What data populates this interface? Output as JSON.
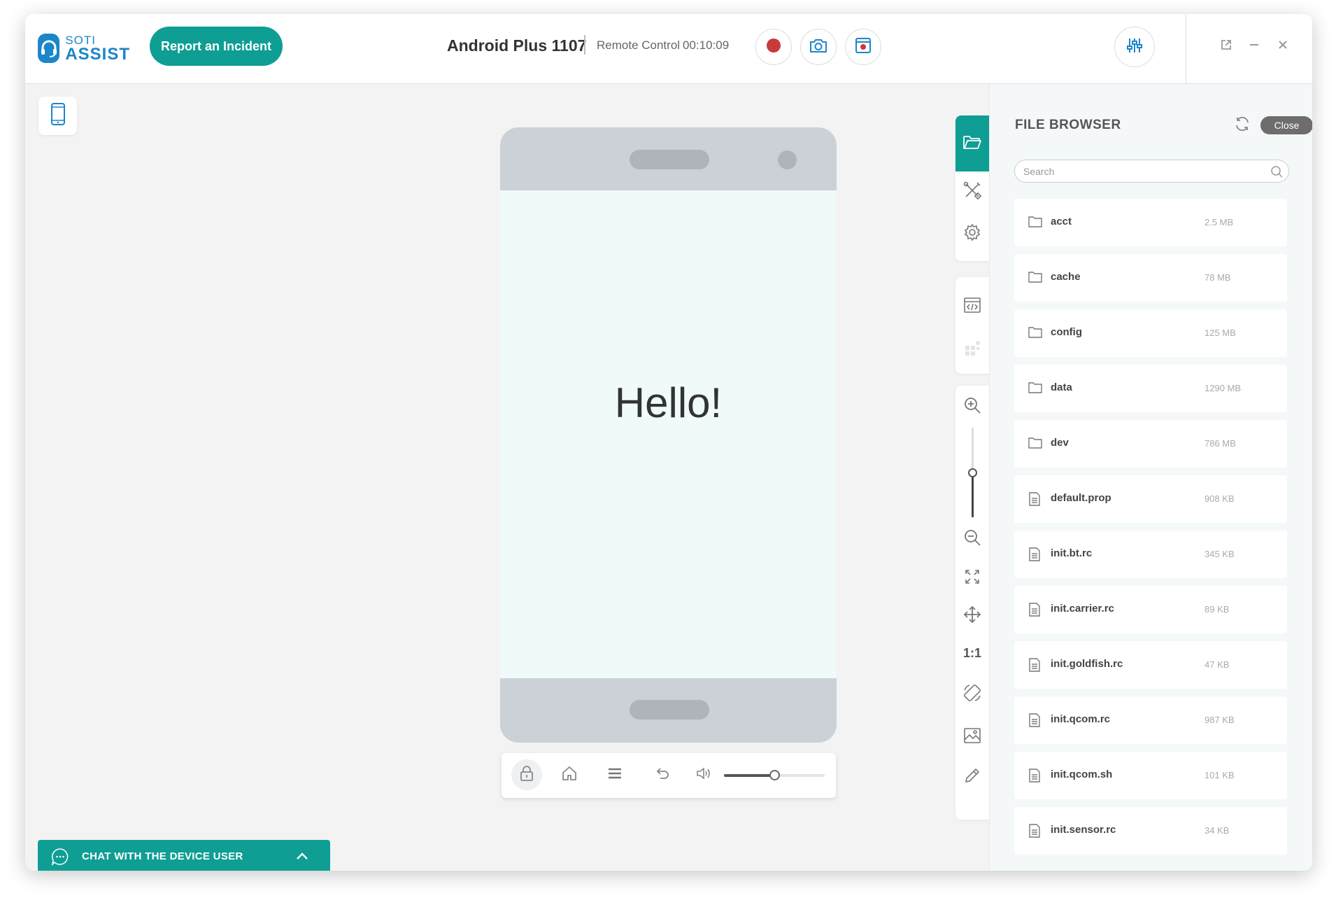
{
  "header": {
    "logo_line1": "SOTI",
    "logo_line2": "ASSIST",
    "report_button": "Report an Incident",
    "device_name": "Android Plus 1107",
    "mode": "Remote Control",
    "timer": "00:10:09"
  },
  "phone": {
    "screen_text": "Hello!"
  },
  "device_toolbar": {
    "volume_level": 0.5
  },
  "side_toolbar": {
    "ratio_label": "1:1",
    "zoom_level": 0.5
  },
  "file_browser": {
    "title": "FILE BROWSER",
    "close_label": "Close",
    "search_placeholder": "Search",
    "items": [
      {
        "name": "acct",
        "size": "2.5 MB",
        "type": "folder"
      },
      {
        "name": "cache",
        "size": "78 MB",
        "type": "folder"
      },
      {
        "name": "config",
        "size": "125 MB",
        "type": "folder"
      },
      {
        "name": "data",
        "size": "1290 MB",
        "type": "folder"
      },
      {
        "name": "dev",
        "size": "786 MB",
        "type": "folder"
      },
      {
        "name": "default.prop",
        "size": "908 KB",
        "type": "file"
      },
      {
        "name": "init.bt.rc",
        "size": "345 KB",
        "type": "file"
      },
      {
        "name": "init.carrier.rc",
        "size": "89 KB",
        "type": "file"
      },
      {
        "name": "init.goldfish.rc",
        "size": "47 KB",
        "type": "file"
      },
      {
        "name": "init.qcom.rc",
        "size": "987 KB",
        "type": "file"
      },
      {
        "name": "init.qcom.sh",
        "size": "101 KB",
        "type": "file"
      },
      {
        "name": "init.sensor.rc",
        "size": "34 KB",
        "type": "file"
      }
    ]
  },
  "chat": {
    "label": "CHAT WITH THE DEVICE USER"
  },
  "colors": {
    "accent": "#0e9e94",
    "brand": "#1b86c8",
    "record": "#c93a3a"
  }
}
